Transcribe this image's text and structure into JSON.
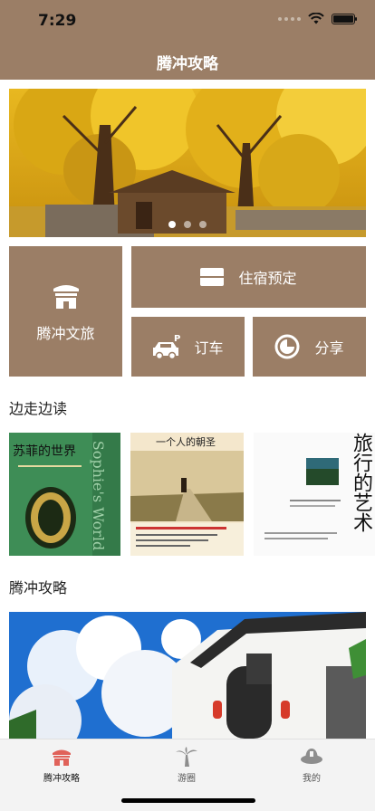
{
  "status": {
    "time": "7:29"
  },
  "nav": {
    "title": "腾冲攻略"
  },
  "grid": {
    "culture_label": "腾冲文旅",
    "lodging_label": "住宿预定",
    "car_label": "订车",
    "share_label": "分享"
  },
  "sections": {
    "reading_title": "边走边读",
    "guide_title": "腾冲攻略"
  },
  "books": [
    {
      "title": "苏菲的世界",
      "spine": "Sophie's World"
    },
    {
      "title": "一个人的朝圣"
    },
    {
      "title": "旅行的艺术"
    }
  ],
  "tabbar": {
    "items": [
      {
        "label": "腾冲攻略",
        "active": true
      },
      {
        "label": "游圈",
        "active": false
      },
      {
        "label": "我的",
        "active": false
      }
    ]
  },
  "colors": {
    "brand": "#9b7e66",
    "active_tab": "#e0625a"
  }
}
